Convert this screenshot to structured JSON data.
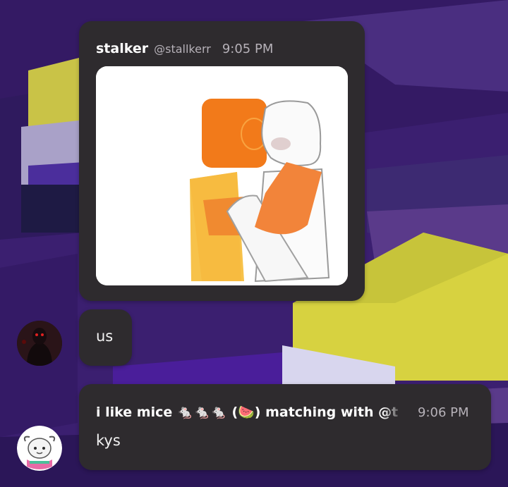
{
  "colors": {
    "bubble": "#2e2b2e",
    "background": "#3a1f6e",
    "timestamp": "#b6b1b8"
  },
  "messages": [
    {
      "display_name": "stalker",
      "handle": "@stallkerr",
      "time": "9:05 PM",
      "attachment": "image"
    },
    {
      "text": "us",
      "avatar": "dark-figure-red-eyes"
    },
    {
      "display_name": "i like mice 🐁🐁🐁 (🍉) matching with @t",
      "time": "9:06 PM",
      "text": "kys",
      "avatar": "white-cartoon-goat"
    }
  ]
}
